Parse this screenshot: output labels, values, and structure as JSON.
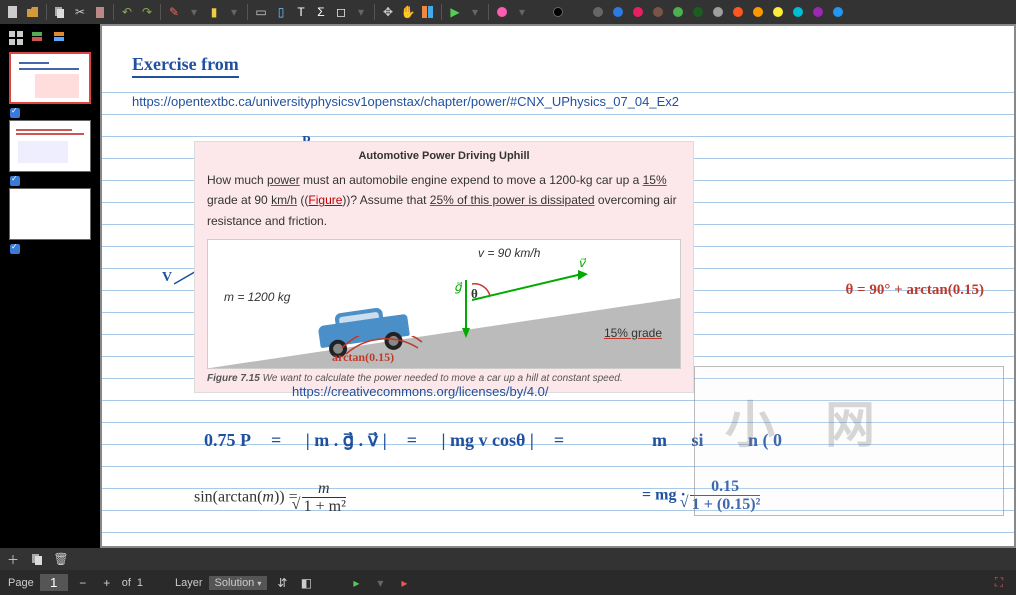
{
  "page": {
    "current": "1",
    "total": "1",
    "of_label": "of"
  },
  "layer": {
    "label": "Layer",
    "current": "Solution"
  },
  "content": {
    "title": "Exercise from",
    "url": "https://opentextbc.ca/universityphysicsv1openstax/chapter/power/#CNX_UPhysics_07_04_Ex2",
    "problem": {
      "heading": "Automotive Power Driving Uphill",
      "text_parts": {
        "p1": "How much ",
        "power": "power",
        "p2": " must an automobile engine expend to move a 1200-kg car up a ",
        "grade": "15%",
        "p3": " grade at 90 ",
        "kmh": "km/h",
        "p4": " ((",
        "fig": "Figure",
        "p5": "))? Assume that ",
        "pct": "25% of this power is dissipated",
        "p6": " overcoming air resistance and friction."
      },
      "diagram": {
        "mass": "m = 1200 kg",
        "velocity": "v = 90 km/h",
        "g_symbol": "g⃗",
        "v_symbol": "v⃗",
        "theta": "θ",
        "grade_text": "15% grade"
      },
      "caption_bold": "Figure 7.15",
      "caption_rest": " We want to calculate the power needed to move a car up a hill at constant speed.",
      "cc_link": "https://creativecommons.org/licenses/by/4.0/"
    },
    "annotations": {
      "P": "P",
      "m": "m",
      "V": "V",
      "arctan": "arctan(0.15)",
      "theta_eq": "θ = 90° + arctan(0.15)"
    },
    "equations": {
      "line1_a": "0.75 P",
      "line1_b": "| m . g⃗ . v⃗ |",
      "line1_c": "| mg v cosθ |",
      "line1_d": "m",
      "line1_e": "si",
      "line1_f": "n ( 0",
      "line2_lhs_a": "sin(arctan(",
      "line2_lhs_m": "m",
      "line2_lhs_b": ")) = ",
      "line2_num": "m",
      "line2_den": "1 + m²",
      "line2r_a": "mg",
      "line2r_num": "0.15",
      "line2r_den": "1 + (0.15)²"
    }
  },
  "colors": {
    "palette": [
      "#ff69b4",
      "#000000",
      "#333333",
      "#666666",
      "#2c7be5",
      "#e91e63",
      "#795548",
      "#4caf50",
      "#1b5e20",
      "#9e9e9e",
      "#ff5722",
      "#ff9800",
      "#ffeb3b",
      "#00bcd4",
      "#9c27b0",
      "#2196f3"
    ]
  }
}
